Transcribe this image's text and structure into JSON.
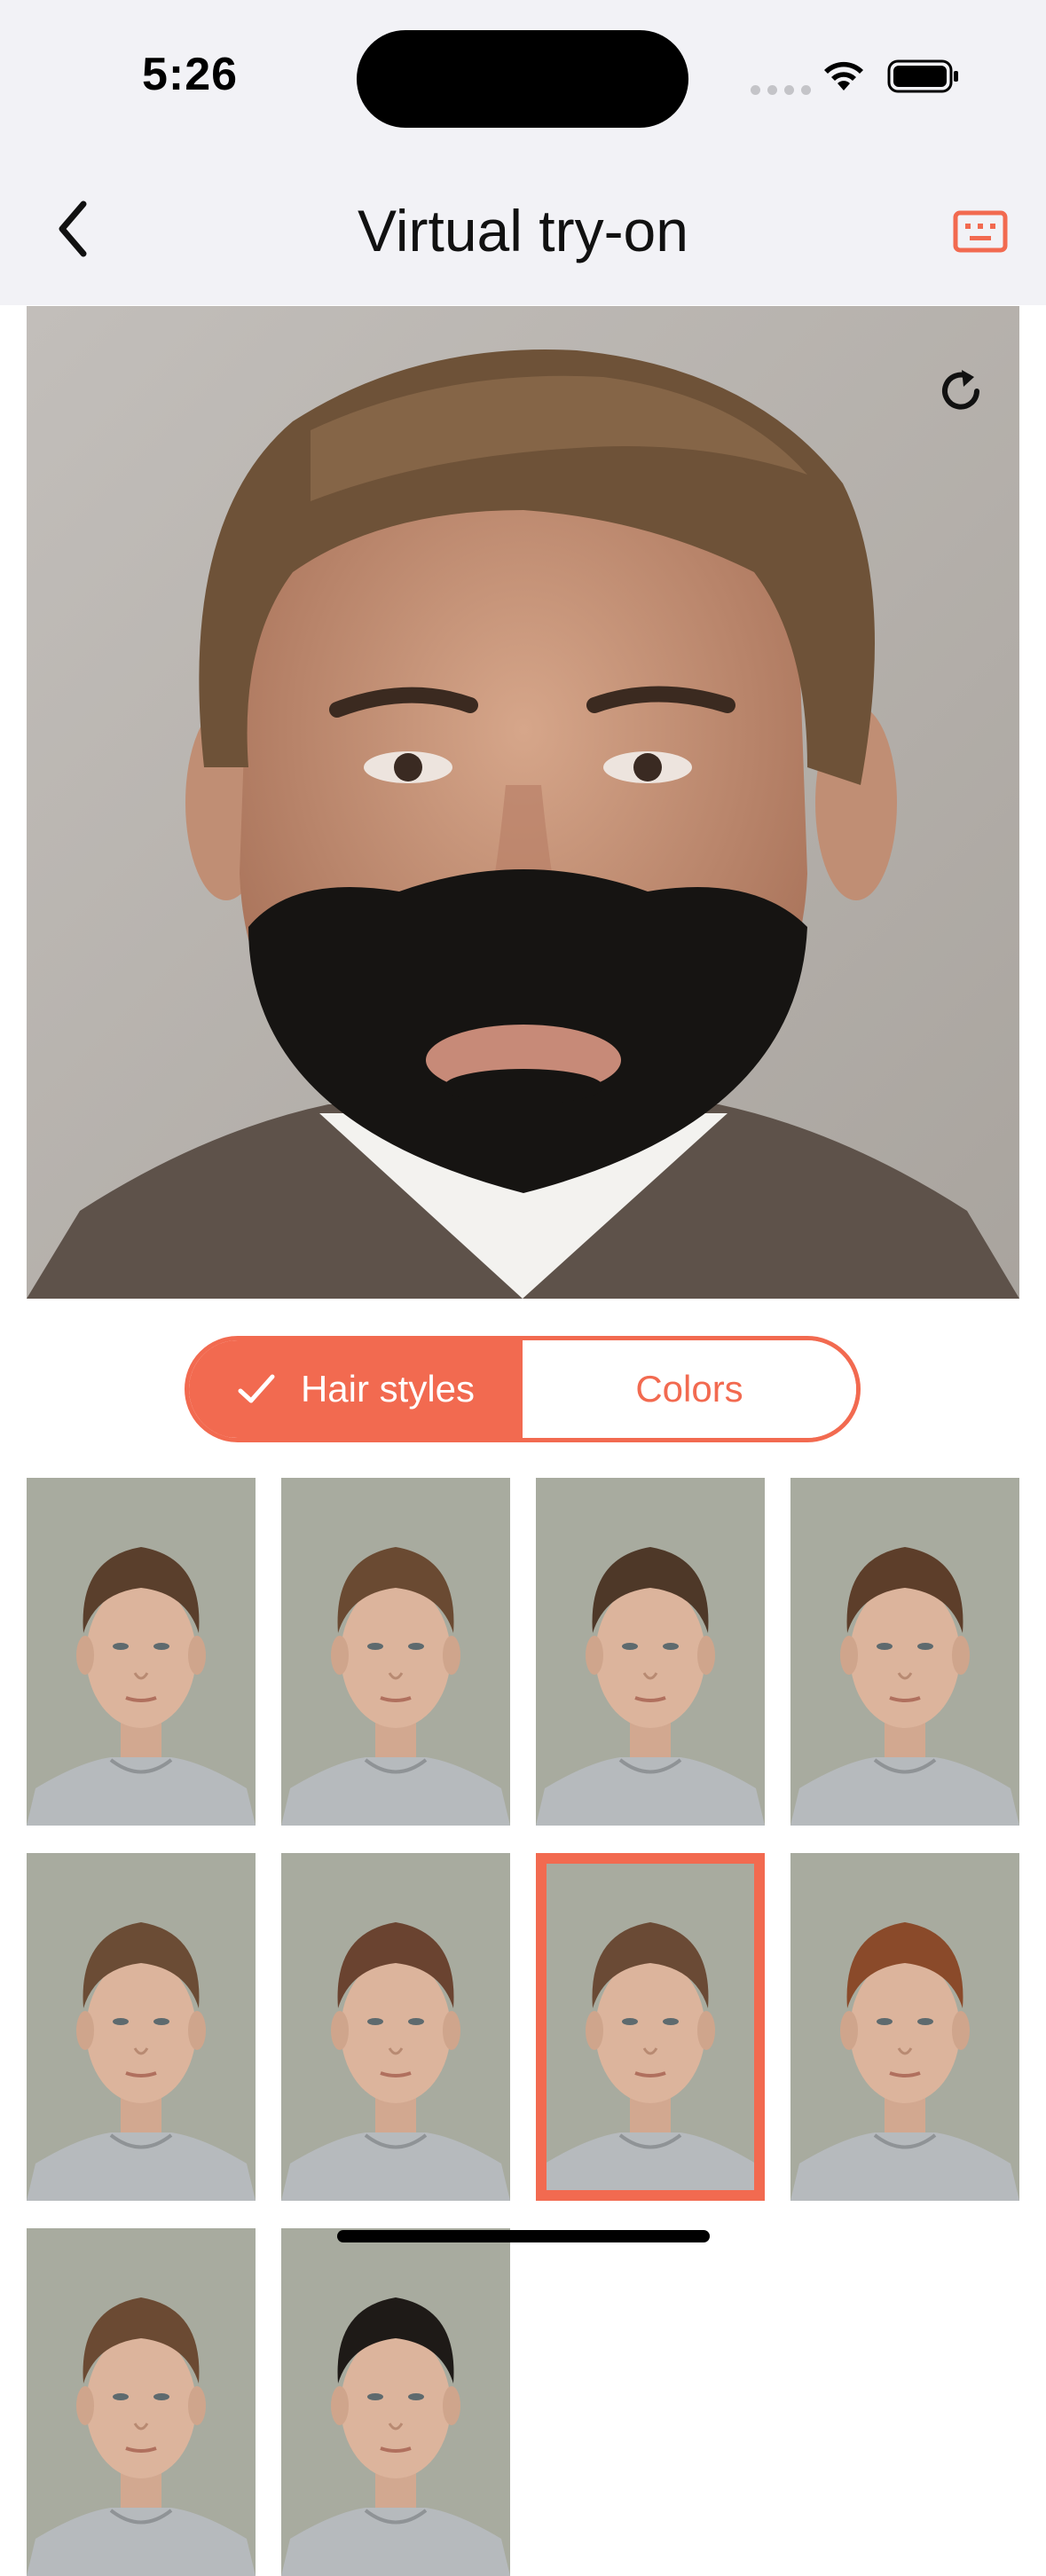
{
  "status_bar": {
    "time": "5:26"
  },
  "nav": {
    "title": "Virtual try-on"
  },
  "tabs": [
    {
      "label": "Hair styles",
      "active": true
    },
    {
      "label": "Colors",
      "active": false
    }
  ],
  "hairstyles": [
    {
      "hair_color": "#5a3f2c",
      "selected": false
    },
    {
      "hair_color": "#6a4a32",
      "selected": false
    },
    {
      "hair_color": "#4e3828",
      "selected": false
    },
    {
      "hair_color": "#5d3e2a",
      "selected": false
    },
    {
      "hair_color": "#6b4c35",
      "selected": false
    },
    {
      "hair_color": "#6a4330",
      "selected": false
    },
    {
      "hair_color": "#6a4a35",
      "selected": true
    },
    {
      "hair_color": "#8a4a2a",
      "selected": false
    },
    {
      "hair_color": "#6b4a33",
      "selected": false
    },
    {
      "hair_color": "#1e1a17",
      "selected": false
    }
  ],
  "colors": {
    "accent": "#f26a50",
    "bar_background": "#f2f2f6"
  }
}
